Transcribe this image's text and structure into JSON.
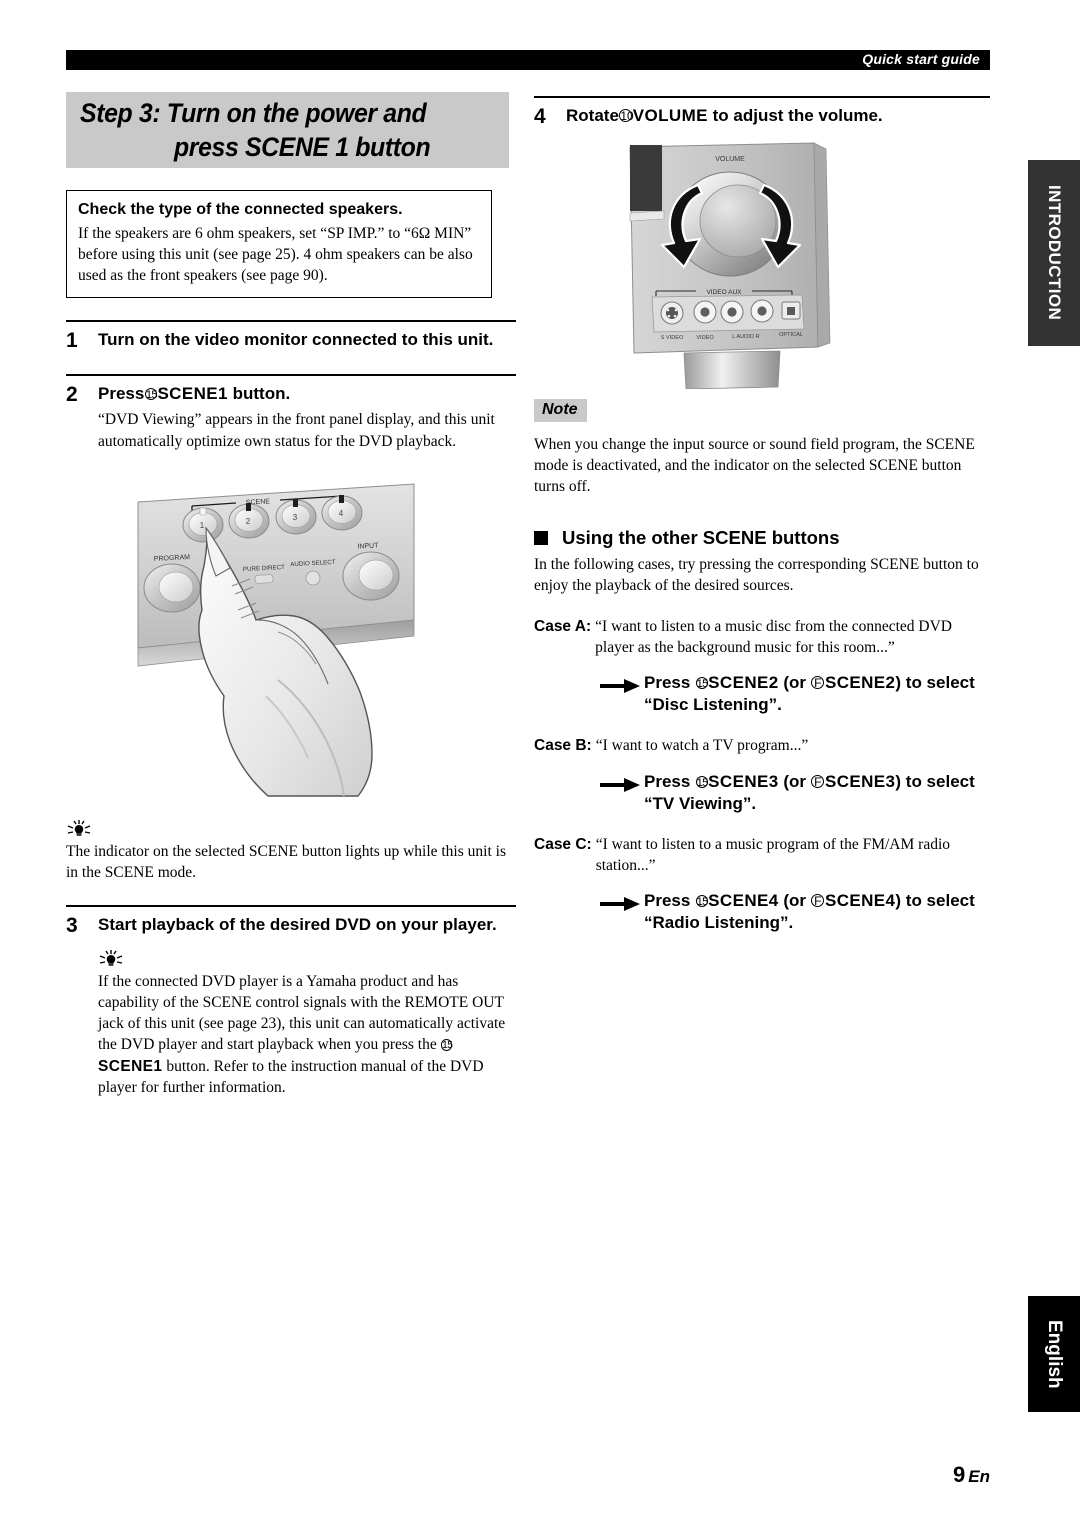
{
  "header": {
    "running_head": "Quick start guide"
  },
  "step_banner": {
    "line1": "Step 3: Turn on the power and",
    "line2": "press SCENE 1 button"
  },
  "callout": {
    "title": "Check the type of the connected speakers.",
    "body": "If the speakers are 6 ohm speakers, set “SP IMP.” to “6Ω MIN” before using this unit (see page 25). 4 ohm speakers can be also used as the front speakers (see page 90)."
  },
  "steps": {
    "one": {
      "number": "1",
      "head": "Turn on the video monitor connected to this unit."
    },
    "two": {
      "number": "2",
      "head_press": "Press",
      "head_circle": "15",
      "head_bold": "SCENE1",
      "head_tail": "button.",
      "body": "“DVD Viewing” appears in the front panel display, and this unit automatically optimize own status for the DVD playback."
    },
    "three": {
      "number": "3",
      "head": "Start playback of the desired DVD on your player.",
      "tip_part1": "If the connected DVD player is a Yamaha product and has capability of the SCENE control signals with the REMOTE OUT jack of this unit (see page 23), this unit can automatically activate the DVD player and start playback when you press the",
      "tip_circle": "15",
      "tip_bold": "SCENE1",
      "tip_part2": "button. Refer to the instruction manual of the DVD player for further information."
    },
    "four": {
      "number": "4",
      "head_rotate": "Rotate",
      "head_circle": "10",
      "head_bold": "VOLUME",
      "head_tail": "to adjust the volume."
    }
  },
  "tip_scene": {
    "text": "The indicator on the selected SCENE button lights up while this unit is in the SCENE mode."
  },
  "panel_illustration": {
    "scene_label": "SCENE",
    "buttons": [
      "1",
      "2",
      "3",
      "4"
    ],
    "program_label": "PROGRAM",
    "pure_direct_label": "PURE DIRECT",
    "audio_select_label": "AUDIO SELECT",
    "input_label": "INPUT"
  },
  "volume_illustration": {
    "volume_label": "VOLUME",
    "video_aux_label": "VIDEO AUX",
    "jacks": [
      "S VIDEO",
      "VIDEO",
      "L  AUDIO  R",
      "OPTICAL"
    ]
  },
  "note": {
    "tag": "Note",
    "body": "When you change the input source or sound field program, the SCENE mode is deactivated, and the indicator on the selected SCENE button turns off."
  },
  "section": {
    "heading": "Using the other SCENE buttons",
    "intro": "In the following cases, try pressing the corresponding SCENE button to enjoy the playback of the desired sources."
  },
  "cases": {
    "a": {
      "label": "Case A:",
      "text": "“I want to listen to a music disc from the connected DVD player as the background music for this room...”",
      "press_prefix": "Press",
      "circle1": "15",
      "bold1": "SCENE2",
      "mid": "(or",
      "circle2": "F",
      "bold2": "SCENE2",
      "tail": ") to select “Disc Listening”."
    },
    "b": {
      "label": "Case B:",
      "text": "“I want to watch a TV program...”",
      "press_prefix": "Press",
      "circle1": "15",
      "bold1": "SCENE3",
      "mid": "(or",
      "circle2": "F",
      "bold2": "SCENE3",
      "tail": ") to select “TV Viewing”."
    },
    "c": {
      "label": "Case C:",
      "text": "“I want to listen to a music program of the FM/AM radio station...”",
      "press_prefix": "Press",
      "circle1": "15",
      "bold1": "SCENE4",
      "mid": "(or",
      "circle2": "F",
      "bold2": "SCENE4",
      "tail": ") to select “Radio Listening”."
    }
  },
  "side_tabs": {
    "introduction": "INTRODUCTION",
    "language": "English"
  },
  "footer": {
    "page_number": "9",
    "suffix": "En"
  },
  "colors": {
    "banner_gray": "#c9c9c9",
    "tab_gray": "#333333",
    "tab_black": "#000000"
  }
}
